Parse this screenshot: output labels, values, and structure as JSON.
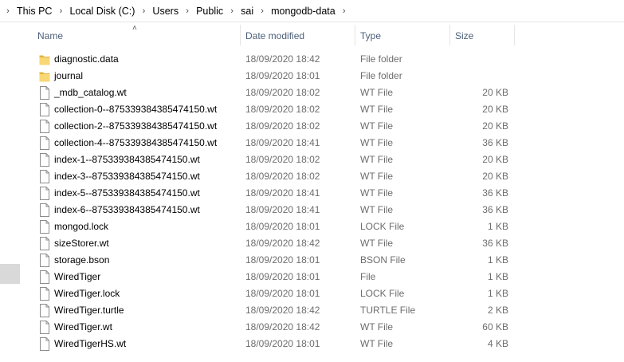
{
  "breadcrumb": [
    "This PC",
    "Local Disk (C:)",
    "Users",
    "Public",
    "sai",
    "mongodb-data"
  ],
  "columns": {
    "name": "Name",
    "date": "Date modified",
    "type": "Type",
    "size": "Size"
  },
  "files": [
    {
      "name": "diagnostic.data",
      "date": "18/09/2020 18:42",
      "type": "File folder",
      "size": "",
      "icon": "folder-icon"
    },
    {
      "name": "journal",
      "date": "18/09/2020 18:01",
      "type": "File folder",
      "size": "",
      "icon": "folder-icon"
    },
    {
      "name": "_mdb_catalog.wt",
      "date": "18/09/2020 18:02",
      "type": "WT File",
      "size": "20 KB",
      "icon": "file-icon"
    },
    {
      "name": "collection-0--875339384385474150.wt",
      "date": "18/09/2020 18:02",
      "type": "WT File",
      "size": "20 KB",
      "icon": "file-icon"
    },
    {
      "name": "collection-2--875339384385474150.wt",
      "date": "18/09/2020 18:02",
      "type": "WT File",
      "size": "20 KB",
      "icon": "file-icon"
    },
    {
      "name": "collection-4--875339384385474150.wt",
      "date": "18/09/2020 18:41",
      "type": "WT File",
      "size": "36 KB",
      "icon": "file-icon"
    },
    {
      "name": "index-1--875339384385474150.wt",
      "date": "18/09/2020 18:02",
      "type": "WT File",
      "size": "20 KB",
      "icon": "file-icon"
    },
    {
      "name": "index-3--875339384385474150.wt",
      "date": "18/09/2020 18:02",
      "type": "WT File",
      "size": "20 KB",
      "icon": "file-icon"
    },
    {
      "name": "index-5--875339384385474150.wt",
      "date": "18/09/2020 18:41",
      "type": "WT File",
      "size": "36 KB",
      "icon": "file-icon"
    },
    {
      "name": "index-6--875339384385474150.wt",
      "date": "18/09/2020 18:41",
      "type": "WT File",
      "size": "36 KB",
      "icon": "file-icon"
    },
    {
      "name": "mongod.lock",
      "date": "18/09/2020 18:01",
      "type": "LOCK File",
      "size": "1 KB",
      "icon": "file-icon"
    },
    {
      "name": "sizeStorer.wt",
      "date": "18/09/2020 18:42",
      "type": "WT File",
      "size": "36 KB",
      "icon": "file-icon"
    },
    {
      "name": "storage.bson",
      "date": "18/09/2020 18:01",
      "type": "BSON File",
      "size": "1 KB",
      "icon": "file-icon"
    },
    {
      "name": "WiredTiger",
      "date": "18/09/2020 18:01",
      "type": "File",
      "size": "1 KB",
      "icon": "file-icon"
    },
    {
      "name": "WiredTiger.lock",
      "date": "18/09/2020 18:01",
      "type": "LOCK File",
      "size": "1 KB",
      "icon": "file-icon"
    },
    {
      "name": "WiredTiger.turtle",
      "date": "18/09/2020 18:42",
      "type": "TURTLE File",
      "size": "2 KB",
      "icon": "file-icon"
    },
    {
      "name": "WiredTiger.wt",
      "date": "18/09/2020 18:42",
      "type": "WT File",
      "size": "60 KB",
      "icon": "file-icon"
    },
    {
      "name": "WiredTigerHS.wt",
      "date": "18/09/2020 18:01",
      "type": "WT File",
      "size": "4 KB",
      "icon": "file-icon"
    }
  ],
  "colors": {
    "folder": "#f8d775",
    "folder_dark": "#e0b53f",
    "header_text": "#4c607a",
    "meta_text": "#6d6d6d"
  }
}
